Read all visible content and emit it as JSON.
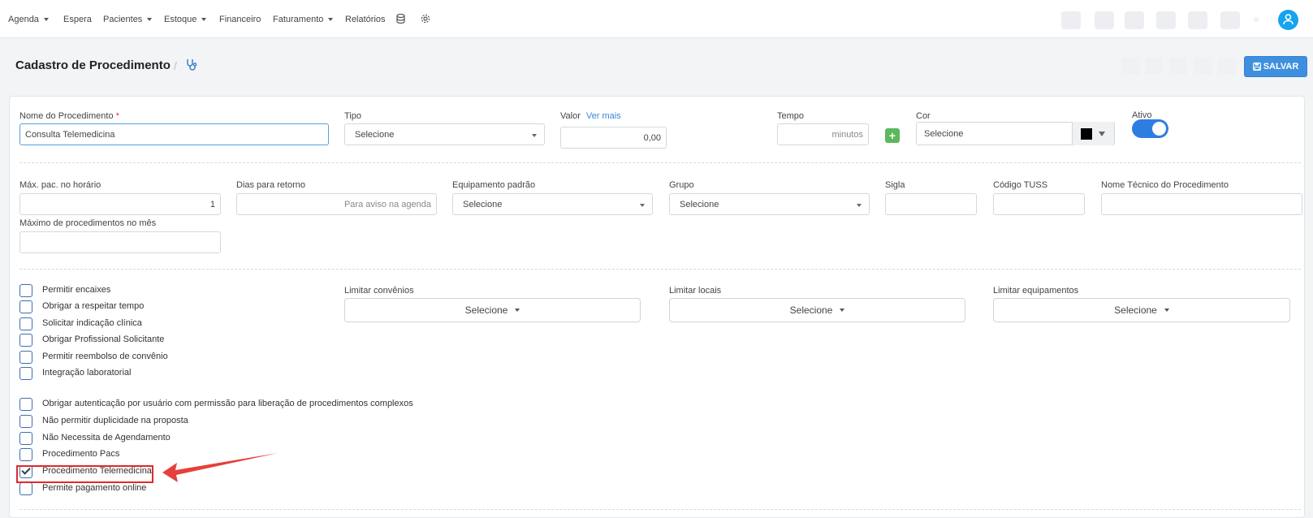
{
  "nav": {
    "items": [
      {
        "label": "Agenda",
        "dropdown": true
      },
      {
        "label": "Espera",
        "dropdown": false
      },
      {
        "label": "Pacientes",
        "dropdown": true
      },
      {
        "label": "Estoque",
        "dropdown": true
      },
      {
        "label": "Financeiro",
        "dropdown": false
      },
      {
        "label": "Faturamento",
        "dropdown": true
      },
      {
        "label": "Relatórios",
        "dropdown": false
      }
    ]
  },
  "header": {
    "title": "Cadastro de Procedimento",
    "separator": "/",
    "save_label": "SALVAR"
  },
  "form": {
    "nome": {
      "label": "Nome do Procedimento",
      "required_mark": "*",
      "value": "Consulta Telemedicina"
    },
    "tipo": {
      "label": "Tipo",
      "value": "Selecione"
    },
    "valor": {
      "label": "Valor",
      "link": "Ver mais",
      "value": "0,00"
    },
    "tempo": {
      "label": "Tempo",
      "placeholder": "minutos"
    },
    "cor": {
      "label": "Cor",
      "value": "Selecione",
      "swatch": "#000000"
    },
    "ativo": {
      "label": "Ativo",
      "on": true,
      "color": "#2e7de1"
    },
    "max_pac": {
      "label": "Máx. pac. no horário",
      "value": "1"
    },
    "dias_retorno": {
      "label": "Dias para retorno",
      "placeholder": "Para aviso na agenda"
    },
    "equipamento": {
      "label": "Equipamento padrão",
      "value": "Selecione"
    },
    "grupo": {
      "label": "Grupo",
      "value": "Selecione"
    },
    "sigla": {
      "label": "Sigla",
      "value": ""
    },
    "tuss": {
      "label": "Código TUSS",
      "value": ""
    },
    "nome_tecnico": {
      "label": "Nome Técnico do Procedimento",
      "value": ""
    },
    "max_mes": {
      "label": "Máximo de procedimentos no mês",
      "value": ""
    }
  },
  "options_a": [
    {
      "label": "Permitir encaixes",
      "checked": false
    },
    {
      "label": "Obrigar a respeitar tempo",
      "checked": false
    },
    {
      "label": "Solicitar indicação clínica",
      "checked": false
    },
    {
      "label": "Obrigar Profissional Solicitante",
      "checked": false
    },
    {
      "label": "Permitir reembolso de convênio",
      "checked": false
    },
    {
      "label": "Integração laboratorial",
      "checked": false
    }
  ],
  "options_b": [
    {
      "label": "Obrigar autenticação por usuário com permissão para liberação de procedimentos complexos",
      "checked": false
    },
    {
      "label": "Não permitir duplicidade na proposta",
      "checked": false
    },
    {
      "label": "Não Necessita de Agendamento",
      "checked": false
    },
    {
      "label": "Procedimento Pacs",
      "checked": false
    },
    {
      "label": "Procedimento Telemedicina",
      "checked": true
    },
    {
      "label": "Permite pagamento online",
      "checked": false
    }
  ],
  "limits": {
    "convenios": {
      "label": "Limitar convênios",
      "value": "Selecione"
    },
    "locais": {
      "label": "Limitar locais",
      "value": "Selecione"
    },
    "equipamentos": {
      "label": "Limitar equipamentos",
      "value": "Selecione"
    }
  },
  "colors": {
    "primary": "#3f8fdf",
    "avatar": "#16a3f0",
    "highlight": "#e02a2a",
    "annotation_arrow": "#e5413a",
    "add_button": "#5cb85c"
  }
}
